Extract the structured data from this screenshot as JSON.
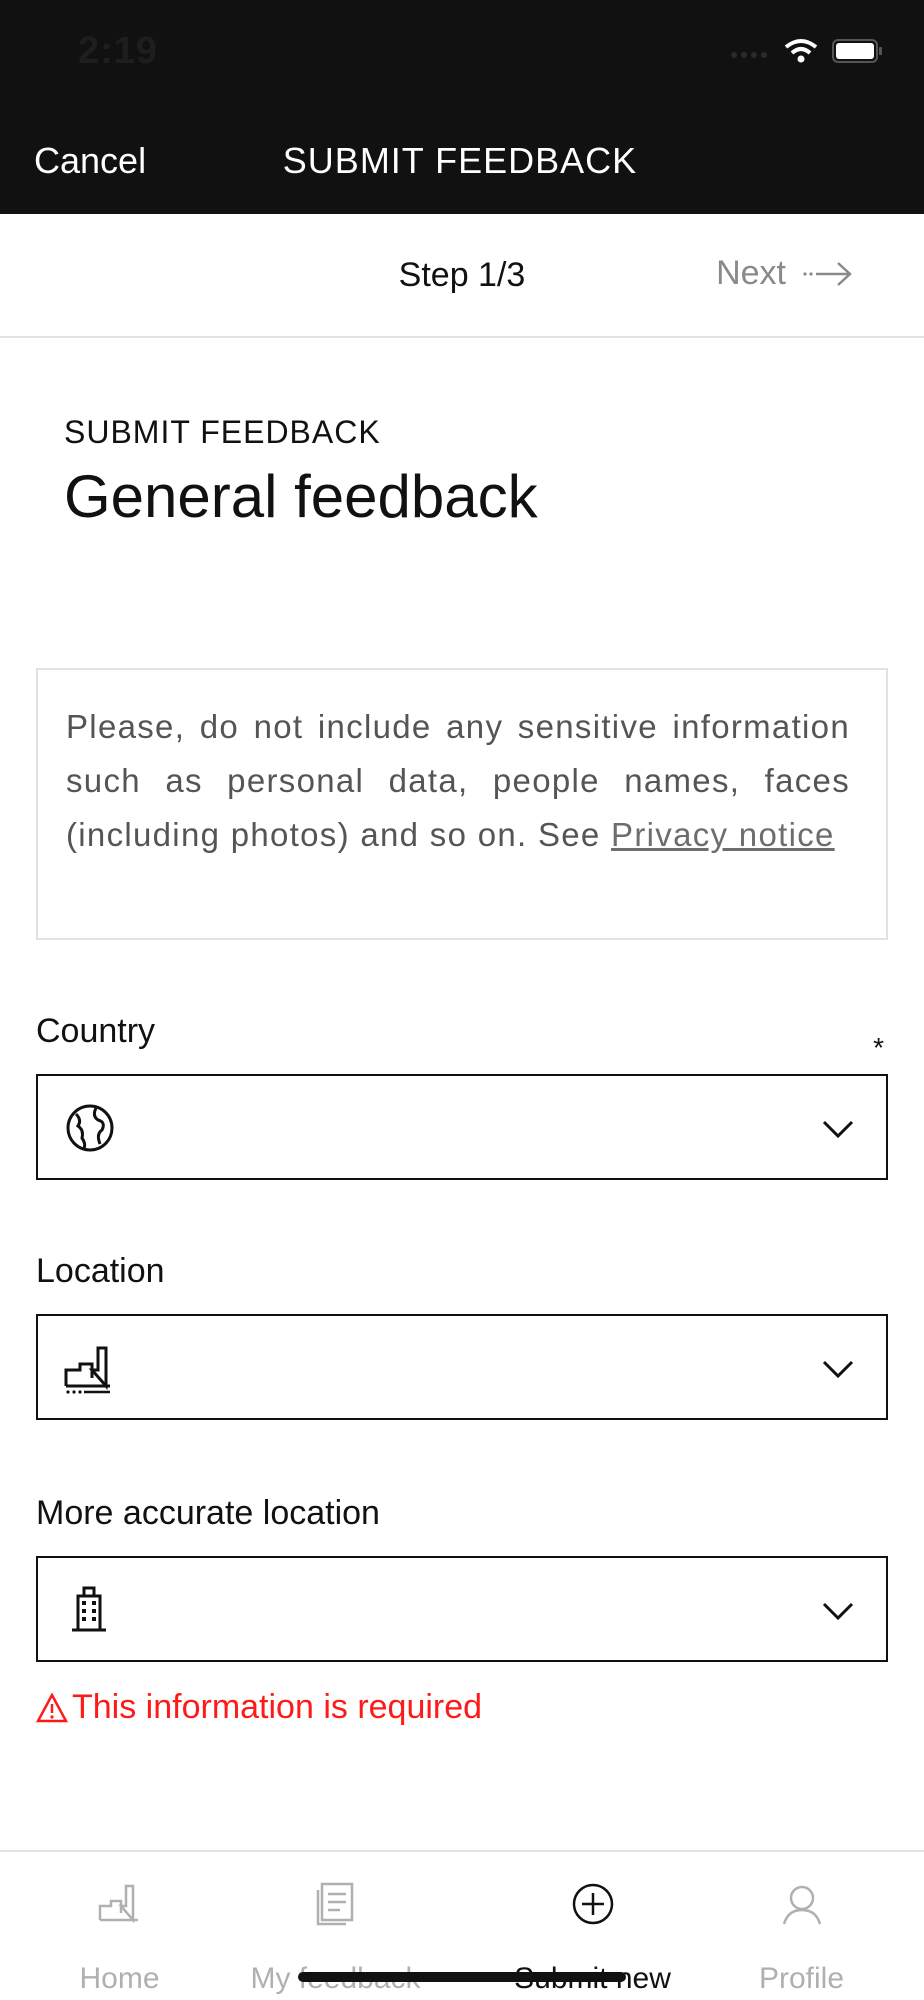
{
  "status_bar": {
    "time": "2:19"
  },
  "nav": {
    "cancel_label": "Cancel",
    "title": "SUBMIT FEEDBACK"
  },
  "stepper": {
    "step_label": "Step 1/3",
    "next_label": "Next"
  },
  "header": {
    "kicker": "SUBMIT FEEDBACK",
    "title": "General feedback"
  },
  "notice": {
    "text": "Please, do not include any sensitive information such as personal data, people names, faces (including photos) and so on. See ",
    "link_label": "Privacy notice"
  },
  "fields": {
    "country": {
      "label": "Country",
      "required_mark": "*",
      "value": "",
      "icon": "globe-icon"
    },
    "location": {
      "label": "Location",
      "value": "",
      "icon": "factory-icon"
    },
    "accurate_location": {
      "label": "More accurate location",
      "value": "",
      "icon": "building-icon"
    }
  },
  "error": {
    "icon": "warning-icon",
    "text": "This information is required"
  },
  "tabs": [
    {
      "label": "Home",
      "icon": "factory-icon",
      "active": false
    },
    {
      "label": "My feedback",
      "icon": "document-icon",
      "active": false
    },
    {
      "label": "Submit new",
      "icon": "plus-circle-icon",
      "active": true
    },
    {
      "label": "Profile",
      "icon": "user-icon",
      "active": false
    }
  ],
  "colors": {
    "header_bg": "#111111",
    "error": "#ff1a1a",
    "inactive_tab": "#b0b0b0"
  }
}
